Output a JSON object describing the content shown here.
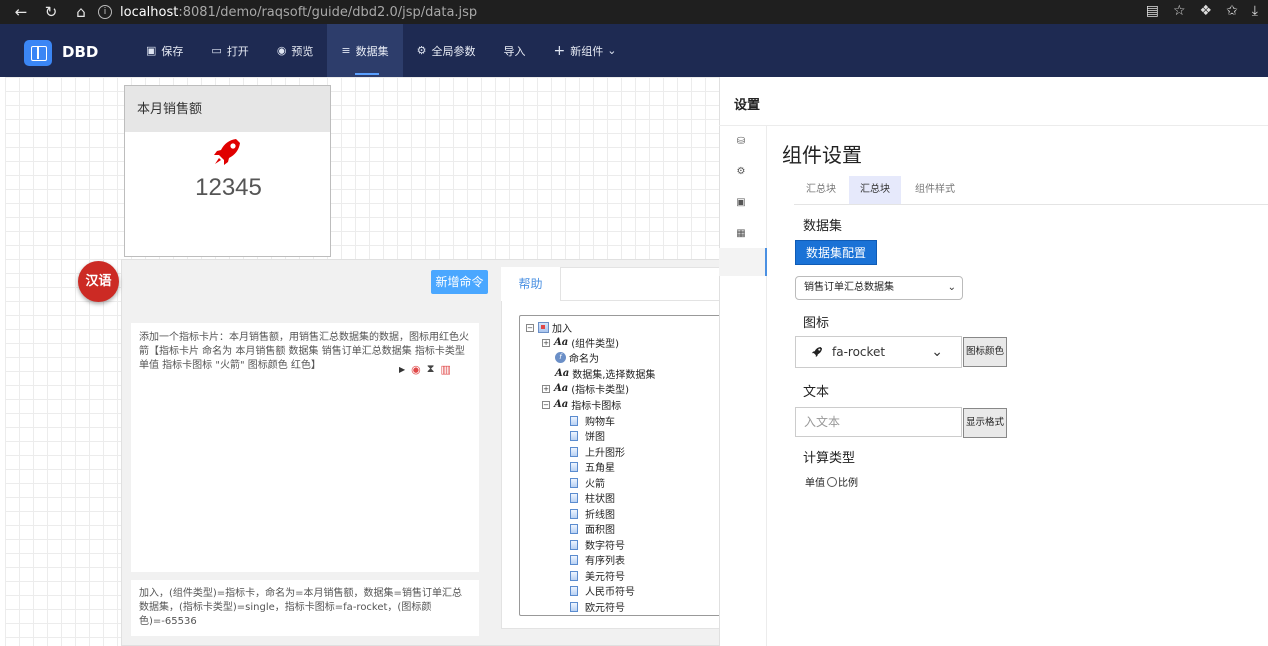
{
  "browser": {
    "url_host": "localhost",
    "url_path": ":8081/demo/raqsoft/guide/dbd2.0/jsp/data.jsp"
  },
  "app": {
    "logo": "DBD",
    "menu": [
      {
        "label": "保存",
        "icon": "save-icon"
      },
      {
        "label": "打开",
        "icon": "folder-icon"
      },
      {
        "label": "预览",
        "icon": "eye-icon"
      },
      {
        "label": "数据集",
        "icon": "database-icon"
      },
      {
        "label": "全局参数",
        "icon": "gear-icon"
      },
      {
        "label": "导入",
        "icon": ""
      },
      {
        "label": "新组件",
        "icon": "plus-icon"
      }
    ],
    "active_menu": "数据集"
  },
  "card": {
    "title": "本月销售额",
    "value": "12345",
    "icon": "rocket-icon",
    "icon_color": "#e00000"
  },
  "lang_badge": "汉语",
  "dialog": {
    "new_command": "新增命令",
    "command_text": "添加一个指标卡片：本月销售额，用销售汇总数据集的数据，图标用红色火箭【指标卡片 命名为 本月销售额 数据集 销售订单汇总数据集 指标卡类型 单值 指标卡图标 \"火箭\" 图标颜色 红色】",
    "result_text": "加入，(组件类型)=指标卡，命名为=本月销售额，数据集=销售订单汇总数据集，(指标卡类型)=single，指标卡图标=fa-rocket，(图标颜色)=-65536",
    "help_tab": "帮助",
    "tree": {
      "root": "加入",
      "component_type": "(组件类型)",
      "name_as": "命名为",
      "dataset_select": "数据集,选择数据集",
      "card_type": "(指标卡类型)",
      "card_icon": "指标卡图标",
      "icons": [
        "购物车",
        "饼图",
        "上升图形",
        "五角星",
        "火箭",
        "柱状图",
        "折线图",
        "面积图",
        "数字符号",
        "有序列表",
        "美元符号",
        "人民币符号",
        "欧元符号"
      ]
    }
  },
  "settings": {
    "title": "设置",
    "component_title": "组件设置",
    "tabs": [
      "汇总块",
      "汇总块",
      "组件样式"
    ],
    "dataset_label": "数据集",
    "dataset_config_btn": "数据集配置",
    "dataset_value": "销售订单汇总数据集",
    "icon_label": "图标",
    "icon_value": "fa-rocket",
    "icon_color_btn": "图标颜色",
    "text_label": "文本",
    "text_placeholder": "入文本",
    "display_format_btn": "显示格式",
    "calc_type_label": "计算类型",
    "calc_single": "单值",
    "calc_ratio": "比例"
  }
}
